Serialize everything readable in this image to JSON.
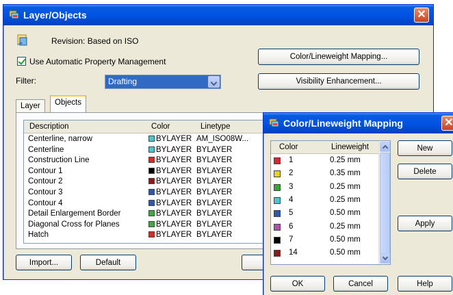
{
  "main_dialog": {
    "title": "Layer/Objects",
    "close_glyph": "✕",
    "revision_text": "Revision: Based on ISO",
    "auto_property_label": "Use Automatic Property Management",
    "auto_property_checked": true,
    "color_mapping_button": "Color/Lineweight Mapping...",
    "visibility_button": "Visibility Enhancement...",
    "filter_label": "Filter:",
    "filter_value": "Drafting",
    "tabs": [
      {
        "label": "Layer",
        "active": false
      },
      {
        "label": "Objects",
        "active": true
      }
    ],
    "columns": {
      "description": "Description",
      "color": "Color",
      "linetype": "Linetype"
    },
    "rows": [
      {
        "description": "Centerline, narrow",
        "color_hex": "#4fc3d0",
        "color": "BYLAYER",
        "linetype": "AM_ISO08W..."
      },
      {
        "description": "Centerline",
        "color_hex": "#4fc3d0",
        "color": "BYLAYER",
        "linetype": "BYLAYER"
      },
      {
        "description": "Construction Line",
        "color_hex": "#d32b2b",
        "color": "BYLAYER",
        "linetype": "BYLAYER"
      },
      {
        "description": "Contour 1",
        "color_hex": "#000000",
        "color": "BYLAYER",
        "linetype": "BYLAYER"
      },
      {
        "description": "Contour 2",
        "color_hex": "#8b1a1a",
        "color": "BYLAYER",
        "linetype": "BYLAYER"
      },
      {
        "description": "Contour 3",
        "color_hex": "#2e58a8",
        "color": "BYLAYER",
        "linetype": "BYLAYER"
      },
      {
        "description": "Contour 4",
        "color_hex": "#2e58a8",
        "color": "BYLAYER",
        "linetype": "BYLAYER"
      },
      {
        "description": "Detail Enlargement Border",
        "color_hex": "#46a546",
        "color": "BYLAYER",
        "linetype": "BYLAYER"
      },
      {
        "description": "Diagonal Cross for Planes",
        "color_hex": "#46a546",
        "color": "BYLAYER",
        "linetype": "BYLAYER"
      },
      {
        "description": "Hatch",
        "color_hex": "#d32b2b",
        "color": "BYLAYER",
        "linetype": "BYLAYER"
      }
    ],
    "import_button": "Import...",
    "default_button": "Default"
  },
  "mapping_dialog": {
    "title": "Color/Lineweight Mapping",
    "close_glyph": "✕",
    "columns": {
      "color": "Color",
      "lineweight": "Lineweight"
    },
    "rows": [
      {
        "color_hex": "#d32b2b",
        "color": "1",
        "lineweight": "0.25 mm"
      },
      {
        "color_hex": "#e6d21e",
        "color": "2",
        "lineweight": "0.35 mm"
      },
      {
        "color_hex": "#3aa63a",
        "color": "3",
        "lineweight": "0.25 mm"
      },
      {
        "color_hex": "#4fc3d0",
        "color": "4",
        "lineweight": "0.25 mm"
      },
      {
        "color_hex": "#2e58a8",
        "color": "5",
        "lineweight": "0.50 mm"
      },
      {
        "color_hex": "#b04fb0",
        "color": "6",
        "lineweight": "0.25 mm"
      },
      {
        "color_hex": "#000000",
        "color": "7",
        "lineweight": "0.50 mm"
      },
      {
        "color_hex": "#8b1a1a",
        "color": "14",
        "lineweight": "0.50 mm"
      }
    ],
    "new_button": "New",
    "delete_button": "Delete",
    "apply_button": "Apply",
    "ok_button": "OK",
    "cancel_button": "Cancel",
    "help_button": "Help"
  }
}
